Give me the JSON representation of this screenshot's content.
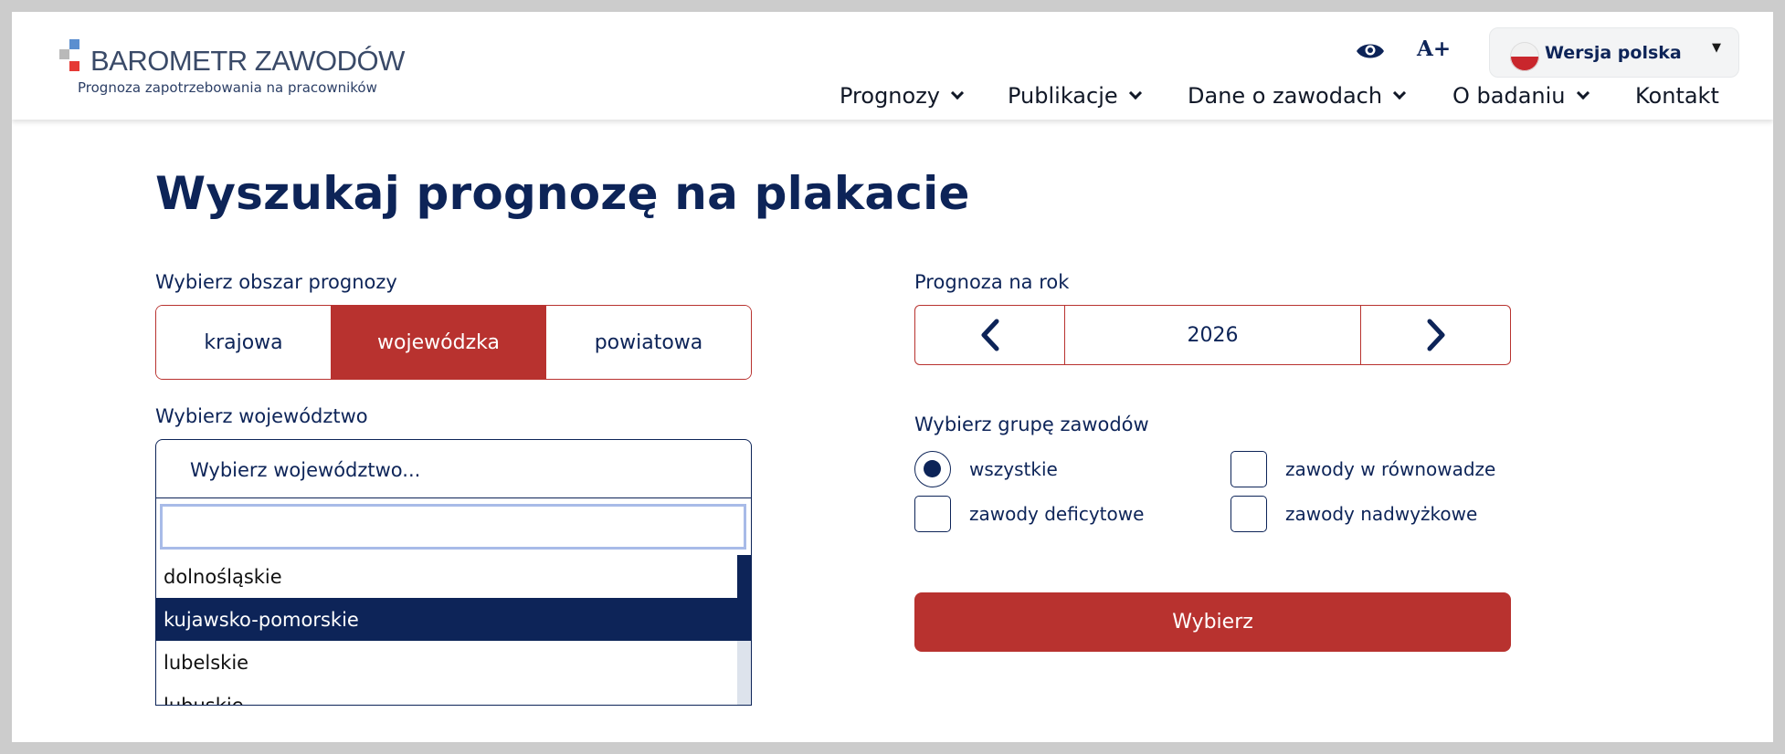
{
  "brand": {
    "title": "BAROMETR ZAWODÓW",
    "subtitle": "Prognoza zapotrzebowania na pracowników",
    "colors": {
      "navy": "#0d2458",
      "red": "#b8322f"
    }
  },
  "toolbar": {
    "contrast_icon": "eye-icon",
    "font_size_label": "A+",
    "language": "Wersja polska",
    "language_icon": "poland-flag-icon"
  },
  "nav": [
    {
      "label": "Prognozy",
      "has_dropdown": true
    },
    {
      "label": "Publikacje",
      "has_dropdown": true
    },
    {
      "label": "Dane o zawodach",
      "has_dropdown": true
    },
    {
      "label": "O badaniu",
      "has_dropdown": true
    },
    {
      "label": "Kontakt",
      "has_dropdown": false
    }
  ],
  "page": {
    "title": "Wyszukaj prognozę na plakacie"
  },
  "area": {
    "label": "Wybierz obszar prognozy",
    "options": [
      "krajowa",
      "wojewódzka",
      "powiatowa"
    ],
    "selected": "wojewódzka"
  },
  "year": {
    "label": "Prognoza na rok",
    "value": "2026"
  },
  "voivodeship": {
    "label": "Wybierz województwo",
    "placeholder": "Wybierz województwo...",
    "search_value": "",
    "options": [
      "dolnośląskie",
      "kujawsko-pomorskie",
      "lubelskie",
      "lubuskie"
    ],
    "highlighted": "kujawsko-pomorskie"
  },
  "group": {
    "label": "Wybierz grupę zawodów",
    "options": [
      "wszystkie",
      "zawody w równowadze",
      "zawody deficytowe",
      "zawody nadwyżkowe"
    ],
    "selected": "wszystkie"
  },
  "submit": {
    "label": "Wybierz"
  }
}
